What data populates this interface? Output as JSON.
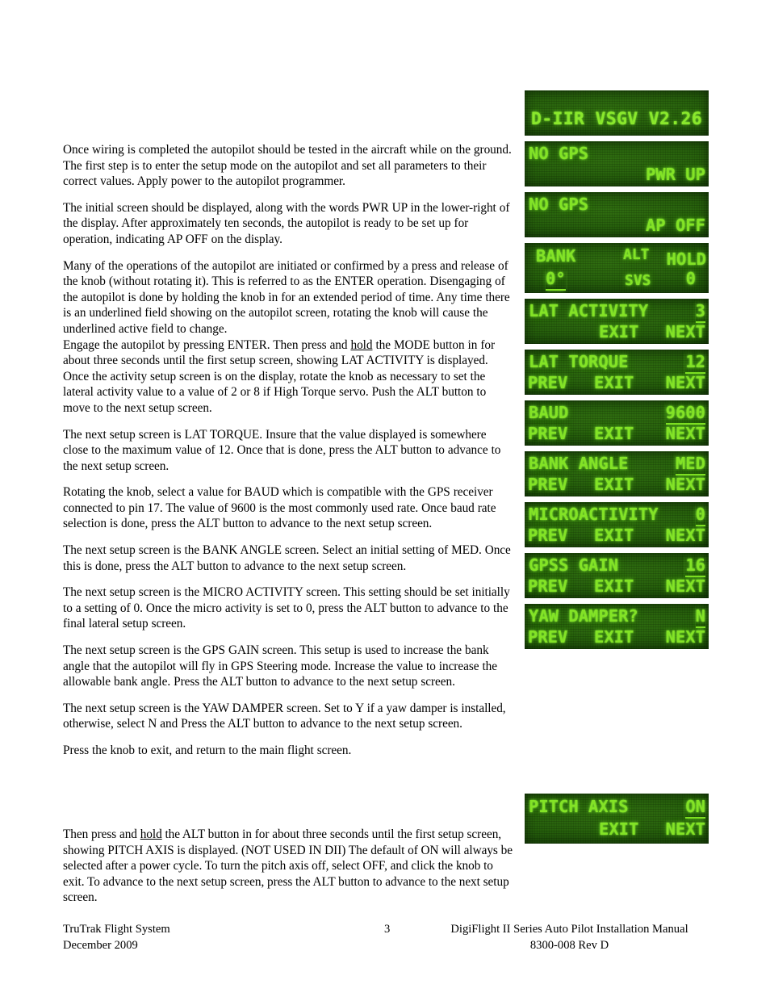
{
  "document": {
    "paragraphs": [
      "Once wiring is completed the autopilot should be tested in the aircraft while on the ground. The first step is to enter the setup mode on the autopilot and set all parameters to their correct values. Apply power to the autopilot programmer.",
      "The initial screen should be displayed, along with the words PWR UP in the lower-right of the display. After approximately ten seconds, the autopilot is ready to be set up for operation, indicating AP OFF on the display.",
      "The next setup screen is LAT TORQUE.   Insure that the value displayed is somewhere close to the maximum value of 12.  Once that is done, press the ALT button to advance to the next setup screen.",
      "Rotating the knob, select a value for BAUD which is compatible with the GPS receiver connected to pin 17. The value of 9600 is the most commonly used rate.  Once baud rate selection is done, press the ALT button to advance to the next setup screen.",
      "The next setup screen is the BANK ANGLE screen.  Select an initial setting of MED. Once this is done, press the ALT button to advance to the next setup screen.",
      "The next setup screen is the MICRO ACTIVITY screen.  This setting should be set initially to a setting of 0.  Once the micro activity is set to 0, press the ALT button to advance to the final lateral setup screen.",
      "The next setup screen is the GPS GAIN screen.  This setup is used to increase the bank angle that the autopilot will fly in GPS Steering mode.  Increase the value to increase the allowable bank angle.  Press the ALT button to advance to the next setup screen.",
      "The next setup screen is the YAW DAMPER screen.  Set to Y if a yaw damper is installed, otherwise, select N and Press the ALT button to advance to the next setup screen.",
      "Press the knob to exit, and return to the main flight screen."
    ],
    "enter_para_a": "Many of the operations of the autopilot are initiated or confirmed by a press and release of the knob (without rotating it). This is referred to as the ENTER operation. Disengaging of the autopilot is done by holding the knob in for an extended period of time. Any time there is an underlined field showing on the autopilot screen, rotating the knob will cause the underlined active field to change.",
    "engage_pre": "Engage the autopilot by pressing ENTER.  Then press and ",
    "engage_hold": "hold",
    "engage_post": " the MODE button in for about three seconds until the first setup screen, showing LAT ACTIVITY is displayed. Once the activity setup screen is on the display, rotate the knob as necessary to set the lateral activity value to a value of 2 or 8 if High Torque servo. Push the ALT button to move to the next setup screen.",
    "pitch_pre": "Then press and ",
    "pitch_hold": "hold",
    "pitch_post": " the ALT button in for about three seconds until the first setup screen, showing PITCH AXIS is displayed. (NOT USED IN DII)   The default of ON will always be selected after a power cycle.  To turn the pitch axis off, select OFF, and click the knob to exit.  To advance to the next setup screen, press the ALT button to advance to the next setup screen."
  },
  "footer": {
    "company": "TruTrak Flight System",
    "date": "December 2009",
    "page_number": "3",
    "manual_title": "DigiFlight II Series Auto Pilot Installation Manual",
    "doc_number": "8300-008  Rev D"
  },
  "colors": {
    "lcd_background": "#1e520a",
    "lcd_text": "#83e326",
    "page_background": "#ffffff",
    "body_text": "#000000"
  },
  "lcd_screens": [
    {
      "id": "version-banner",
      "banner": "D-IIR VSGV V2.26"
    },
    {
      "id": "pwr-up",
      "row1_left": "NO GPS",
      "row2_right": "PWR UP"
    },
    {
      "id": "ap-off",
      "row1_left": "NO GPS",
      "row2_right": "AP OFF"
    },
    {
      "id": "flight-status",
      "bank_label": "BANK",
      "alt_label": "ALT",
      "hold_label": "HOLD",
      "bank_value": "0°",
      "svs_label": "SVS",
      "svs_value": "0"
    },
    {
      "id": "lat-activity",
      "label": "LAT ACTIVITY",
      "value": "3",
      "btn_exit": "EXIT",
      "btn_next": "NEXT"
    },
    {
      "id": "lat-torque",
      "label": "LAT TORQUE",
      "value": "12",
      "btn_prev": "PREV",
      "btn_exit": "EXIT",
      "btn_next": "NEXT"
    },
    {
      "id": "baud",
      "label": "BAUD",
      "value": "9600",
      "btn_prev": "PREV",
      "btn_exit": "EXIT",
      "btn_next": "NEXT"
    },
    {
      "id": "bank-angle",
      "label": "BANK ANGLE",
      "value": "MED",
      "btn_prev": "PREV",
      "btn_exit": "EXIT",
      "btn_next": "NEXT"
    },
    {
      "id": "microactivity",
      "label": "MICROACTIVITY",
      "value": "0",
      "btn_prev": "PREV",
      "btn_exit": "EXIT",
      "btn_next": "NEXT"
    },
    {
      "id": "gpss-gain",
      "label": "GPSS GAIN",
      "value": "16",
      "btn_prev": "PREV",
      "btn_exit": "EXIT",
      "btn_next": "NEXT"
    },
    {
      "id": "yaw-damper",
      "label": "YAW DAMPER?",
      "value": "N",
      "btn_prev": "PREV",
      "btn_exit": "EXIT",
      "btn_next": "NEXT"
    },
    {
      "id": "pitch-axis",
      "label": "PITCH AXIS",
      "value": "ON",
      "btn_exit": "EXIT",
      "btn_next": "NEXT"
    }
  ]
}
